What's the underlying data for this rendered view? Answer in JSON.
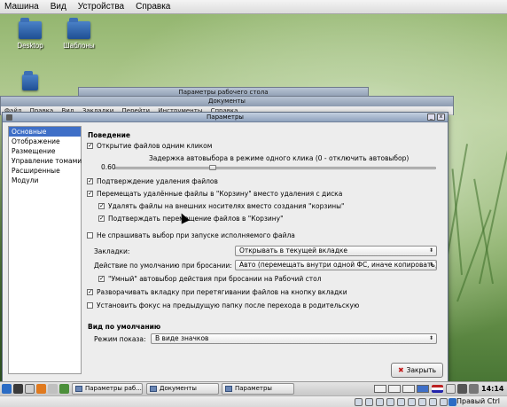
{
  "host_menu": [
    "Машина",
    "Вид",
    "Устройства",
    "Справка"
  ],
  "desktop_icons": [
    {
      "label": "Desktop"
    },
    {
      "label": "Шаблоны"
    },
    {
      "label": ""
    }
  ],
  "bg_windows": {
    "desktop_settings_title": "Параметры рабочего стола",
    "documents_title": "Документы",
    "documents_menu": [
      "Файл",
      "Правка",
      "Вид",
      "Закладки",
      "Перейти",
      "Инструменты",
      "Справка"
    ]
  },
  "dialog": {
    "title": "Параметры",
    "sidebar": [
      "Основные",
      "Отображение",
      "Размещение",
      "Управление томами",
      "Расширенные",
      "Модули"
    ],
    "selected_sidebar": 0,
    "behavior": {
      "section_title": "Поведение",
      "single_click": {
        "label": "Открытие файлов одним кликом",
        "checked": true
      },
      "delay_label": "Задержка автовыбора в режиме одного клика (0 - отключить автовыбор)",
      "delay_value": "0.60",
      "delay_fraction": 0.3,
      "confirm_delete": {
        "label": "Подтверждение удаления файлов",
        "checked": true
      },
      "move_to_trash": {
        "label": "Перемещать удалённые файлы в \"Корзину\" вместо удаления с диска",
        "checked": true
      },
      "delete_external": {
        "label": "Удалять файлы на внешних носителях вместо создания \"корзины\"",
        "checked": true
      },
      "confirm_trash": {
        "label": "Подтверждать перемещение файлов в \"Корзину\"",
        "checked": true
      },
      "no_exec_prompt": {
        "label": "Не спрашивать выбор при запуске исполняемого файла",
        "checked": false
      },
      "bookmarks_label": "Закладки:",
      "bookmarks_value": "Открывать в текущей вкладке",
      "drop_label": "Действие по умолчанию при бросании:",
      "drop_value": "Авто (перемещать внутри одной ФС, иначе копировать)",
      "smart_drop": {
        "label": "\"Умный\" автовыбор действия при бросании на Рабочий стол",
        "checked": true
      },
      "unfold_tab": {
        "label": "Разворачивать вкладку при перетягивании файлов на кнопку вкладки",
        "checked": true
      },
      "focus_parent": {
        "label": "Установить фокус на предыдущую папку после перехода в родительскую",
        "checked": false
      }
    },
    "default_view": {
      "section_title": "Вид по умолчанию",
      "mode_label": "Режим показа:",
      "mode_value": "В виде значков"
    },
    "close_label": "Закрыть"
  },
  "taskbar": {
    "tasks": [
      "Параметры раб...",
      "Документы",
      "Параметры"
    ],
    "clock": "14:14"
  },
  "vm_status": {
    "host_key": "Правый Ctrl"
  },
  "colors": {
    "selection": "#3f6fc7",
    "title_bar": "#8fa2bd",
    "close_icon": "#c21a1a"
  }
}
